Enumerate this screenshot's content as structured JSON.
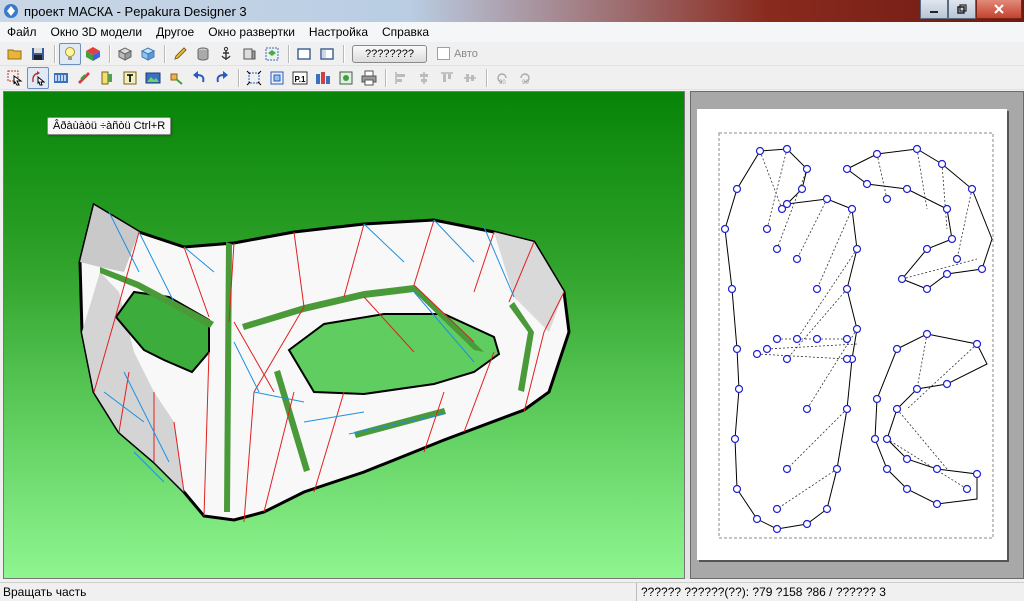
{
  "window": {
    "title": "проект МАСКА - Pepakura Designer 3",
    "controls": [
      "minimize",
      "maximize",
      "close"
    ]
  },
  "menu": {
    "items": [
      "Файл",
      "Окно 3D модели",
      "Другое",
      "Окно развертки",
      "Настройка",
      "Справка"
    ]
  },
  "toolbar1": {
    "icons": [
      "open-folder-icon",
      "save-disk-icon",
      "light-bulb-icon",
      "color-cube-icon",
      "box-icon",
      "texture-box-icon",
      "pencil-icon",
      "cylinder-icon",
      "anchor-icon",
      "flat-box-icon",
      "unfold-icon",
      "single-view-icon",
      "split-view-icon"
    ],
    "unfold_button_label": "????????",
    "auto_checkbox_label": "Авто"
  },
  "toolbar2": {
    "icons": [
      "select-arrow-icon",
      "rotate-part-icon",
      "join-edges-icon",
      "tabs-icon",
      "flap-icon",
      "text-icon",
      "image-icon",
      "move-part-icon",
      "undo-icon",
      "redo-icon",
      "fit-page-icon",
      "group-icon",
      "page-number-icon",
      "print-layout-icon",
      "image-export-icon",
      "print-icon",
      "align-left-icon",
      "align-center-icon",
      "align-top-icon",
      "align-middle-icon",
      "rotate-ccw-90-icon",
      "rotate-cw-90-icon"
    ]
  },
  "tooltip": {
    "text": "Âðàùàòü ÷àñòü Ctrl+R"
  },
  "statusbar": {
    "left": "Вращать часть",
    "right": "?????? ??????(??): ?79 ?158 ?86 / ?????? 3"
  },
  "colors": {
    "viewport_top": "#078408",
    "viewport_bottom": "#8ff58f",
    "mountain_fold": "#e02020",
    "valley_fold": "#2090e0",
    "glue_flap": "#4a9a3a",
    "node": "#2020d0"
  }
}
